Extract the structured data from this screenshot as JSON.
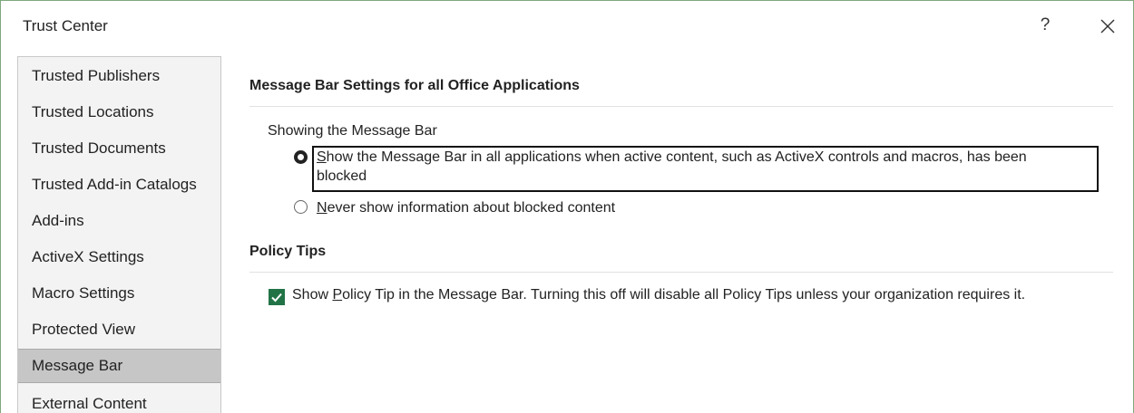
{
  "window": {
    "title": "Trust Center",
    "help_label": "?"
  },
  "sidebar": {
    "items": [
      {
        "label": "Trusted Publishers"
      },
      {
        "label": "Trusted Locations"
      },
      {
        "label": "Trusted Documents"
      },
      {
        "label": "Trusted Add-in Catalogs"
      },
      {
        "label": "Add-ins"
      },
      {
        "label": "ActiveX Settings"
      },
      {
        "label": "Macro Settings"
      },
      {
        "label": "Protected View"
      },
      {
        "label": "Message Bar",
        "selected": true
      },
      {
        "label": "External Content"
      }
    ]
  },
  "message_bar": {
    "heading": "Message Bar Settings for all Office Applications",
    "group_label": "Showing the Message Bar",
    "options": [
      {
        "mnemonic": "S",
        "line1_rest": "how the Message Bar in all applications when active content, such as ActiveX controls and macros, has been",
        "line2": "blocked",
        "checked": true
      },
      {
        "mnemonic": "N",
        "line1_rest": "ever show information about blocked content",
        "checked": false
      }
    ]
  },
  "policy_tips": {
    "heading": "Policy Tips",
    "checkbox": {
      "before": "Show ",
      "mnemonic": "P",
      "after": "olicy Tip in the Message Bar. Turning this off will disable all Policy Tips unless your organization requires it.",
      "checked": true
    }
  },
  "colors": {
    "checkbox_fill": "#217346",
    "selected_item_bg": "#c6c6c6",
    "sidebar_bg": "#f3f3f3",
    "window_border": "#7fa87f"
  }
}
